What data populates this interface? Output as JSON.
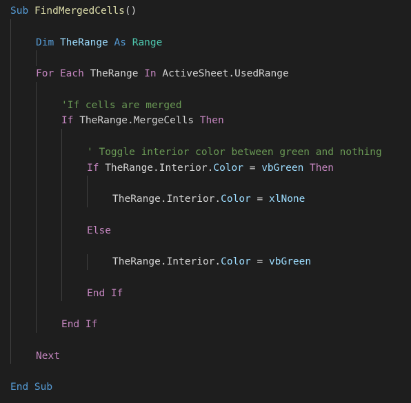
{
  "editor": {
    "language": "vba",
    "colors": {
      "background": "#1e1e1e",
      "keyword": "#569cd6",
      "control": "#c586c0",
      "function": "#dcdcaa",
      "type": "#4ec9b0",
      "comment": "#6a9955",
      "property": "#9cdcfe",
      "text": "#d4d4d4"
    },
    "lines": [
      {
        "indent": 0,
        "tokens": [
          [
            "kw",
            "Sub"
          ],
          [
            "id",
            " "
          ],
          [
            "fn",
            "FindMergedCells"
          ],
          [
            "id",
            "()"
          ]
        ]
      },
      {
        "indent": 0,
        "tokens": []
      },
      {
        "indent": 1,
        "tokens": [
          [
            "kw",
            "Dim"
          ],
          [
            "id",
            " "
          ],
          [
            "var",
            "TheRange"
          ],
          [
            "id",
            " "
          ],
          [
            "kw",
            "As"
          ],
          [
            "id",
            " "
          ],
          [
            "ty",
            "Range"
          ]
        ]
      },
      {
        "indent": 0,
        "tokens": []
      },
      {
        "indent": 1,
        "tokens": [
          [
            "ctl",
            "For"
          ],
          [
            "id",
            " "
          ],
          [
            "ctl",
            "Each"
          ],
          [
            "id",
            " TheRange "
          ],
          [
            "ctl",
            "In"
          ],
          [
            "id",
            " ActiveSheet.UsedRange"
          ]
        ]
      },
      {
        "indent": 0,
        "tokens": []
      },
      {
        "indent": 2,
        "tokens": [
          [
            "cm",
            "'If cells are merged"
          ]
        ]
      },
      {
        "indent": 2,
        "tokens": [
          [
            "ctl",
            "If"
          ],
          [
            "id",
            " TheRange.MergeCells "
          ],
          [
            "ctl",
            "Then"
          ]
        ]
      },
      {
        "indent": 0,
        "tokens": []
      },
      {
        "indent": 3,
        "tokens": [
          [
            "cm",
            "' Toggle interior color between green and nothing"
          ]
        ]
      },
      {
        "indent": 3,
        "tokens": [
          [
            "ctl",
            "If"
          ],
          [
            "id",
            " TheRange.Interior."
          ],
          [
            "var",
            "Color"
          ],
          [
            "id",
            " = "
          ],
          [
            "var",
            "vbGreen"
          ],
          [
            "id",
            " "
          ],
          [
            "ctl",
            "Then"
          ]
        ]
      },
      {
        "indent": 0,
        "tokens": []
      },
      {
        "indent": 4,
        "tokens": [
          [
            "id",
            "TheRange.Interior."
          ],
          [
            "var",
            "Color"
          ],
          [
            "id",
            " = "
          ],
          [
            "var",
            "xlNone"
          ]
        ]
      },
      {
        "indent": 0,
        "tokens": []
      },
      {
        "indent": 3,
        "tokens": [
          [
            "ctl",
            "Else"
          ]
        ]
      },
      {
        "indent": 0,
        "tokens": []
      },
      {
        "indent": 4,
        "tokens": [
          [
            "id",
            "TheRange.Interior."
          ],
          [
            "var",
            "Color"
          ],
          [
            "id",
            " = "
          ],
          [
            "var",
            "vbGreen"
          ]
        ]
      },
      {
        "indent": 0,
        "tokens": []
      },
      {
        "indent": 3,
        "tokens": [
          [
            "ctl",
            "End If"
          ]
        ]
      },
      {
        "indent": 0,
        "tokens": []
      },
      {
        "indent": 2,
        "tokens": [
          [
            "ctl",
            "End If"
          ]
        ]
      },
      {
        "indent": 0,
        "tokens": []
      },
      {
        "indent": 1,
        "tokens": [
          [
            "ctl",
            "Next"
          ]
        ]
      },
      {
        "indent": 0,
        "tokens": []
      },
      {
        "indent": 0,
        "tokens": [
          [
            "kw",
            "End Sub"
          ]
        ]
      }
    ]
  }
}
